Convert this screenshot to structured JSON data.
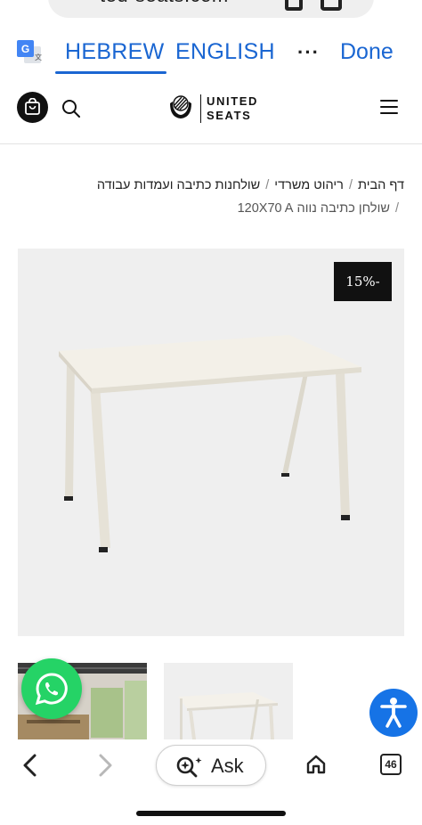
{
  "browser": {
    "url_partial": "ted-seats.com"
  },
  "translate_bar": {
    "source_lang": "HEBREW",
    "target_lang": "ENGLISH",
    "more_label": "···",
    "done_label": "Done",
    "active_tab": "HEBREW",
    "accent_color": "#1a66d2"
  },
  "site_header": {
    "logo_line1": "UNITED",
    "logo_line2": "SEATS",
    "cart_icon": "shopping-bag-icon",
    "search_icon": "search-icon",
    "menu_icon": "hamburger-menu-icon"
  },
  "breadcrumb": {
    "items": [
      "דף הבית",
      "ריהוט משרדי",
      "שולחנות כתיבה ועמדות עבודה"
    ],
    "separator": "/",
    "current": "שולחן כתיבה נווה 120X70 A"
  },
  "product": {
    "discount_badge": "15%-",
    "image_subject": "white office desk"
  },
  "floating": {
    "whatsapp_icon": "whatsapp-icon",
    "whatsapp_color": "#25d366",
    "accessibility_icon": "accessibility-icon",
    "accessibility_color": "#1673e6"
  },
  "bottom_toolbar": {
    "ask_label": "Ask",
    "tab_count": "46",
    "back_icon": "chevron-left-icon",
    "forward_icon": "chevron-right-icon",
    "home_icon": "home-icon"
  }
}
